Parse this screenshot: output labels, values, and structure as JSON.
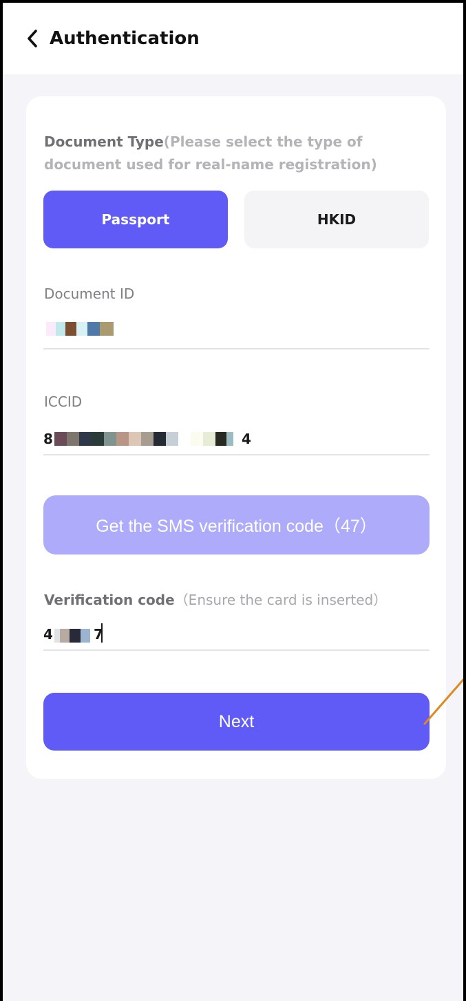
{
  "header": {
    "title": "Authentication",
    "back_icon": "chevron-left-icon"
  },
  "document_type": {
    "label": "Document Type",
    "hint": "(Please select the type of document used for real-name registration)",
    "options": [
      "Passport",
      "HKID"
    ],
    "selected": "Passport"
  },
  "document_id": {
    "label": "Document ID",
    "value_masked": true
  },
  "iccid": {
    "label": "ICCID",
    "prefix": "8",
    "suffix": "4",
    "value_masked": true
  },
  "sms_button": {
    "label": "Get the SMS verification code（47）",
    "countdown_seconds": 47,
    "enabled": false
  },
  "verification": {
    "label": "Verification code",
    "hint": "（Ensure the card is inserted）",
    "prefix": "4",
    "suffix": "7",
    "value_masked": true
  },
  "next_button": {
    "label": "Next"
  },
  "colors": {
    "primary": "#605bf6",
    "primary_disabled": "#aeabfa",
    "page_bg": "#f4f4f9",
    "annotation": "#e08a1e"
  }
}
